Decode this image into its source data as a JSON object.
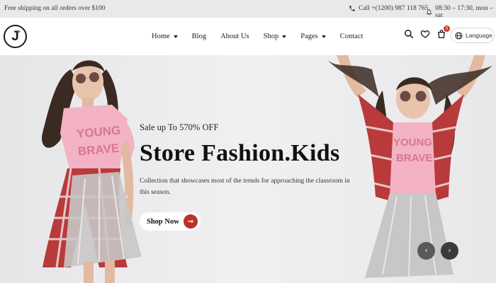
{
  "topbar": {
    "shipping": "Free shipping on all orders over $100",
    "call": "Call +(1200) 987 118 765",
    "hours": "08:30 – 17:30, mon – sat"
  },
  "header": {
    "logo": "J",
    "nav": [
      {
        "label": "Home",
        "dropdown": true
      },
      {
        "label": "Blog",
        "dropdown": false
      },
      {
        "label": "About Us",
        "dropdown": false
      },
      {
        "label": "Shop",
        "dropdown": true
      },
      {
        "label": "Pages",
        "dropdown": true
      },
      {
        "label": "Contact",
        "dropdown": false
      }
    ],
    "cart_count": "0",
    "language": "Language"
  },
  "hero": {
    "subtitle": "Sale up To 570% OFF",
    "title": "Store Fashion.Kids",
    "description": "Collection that showcases most of the trends for approaching the classroom in this season.",
    "button": "Shop Now",
    "left_shirt_text": "YOUNG BRAVE",
    "right_shirt_text": "YOUNG BRAVE"
  },
  "colors": {
    "accent": "#b8322c",
    "topbar_bg": "#e9e9ea",
    "hero_bg": "#ececee"
  }
}
